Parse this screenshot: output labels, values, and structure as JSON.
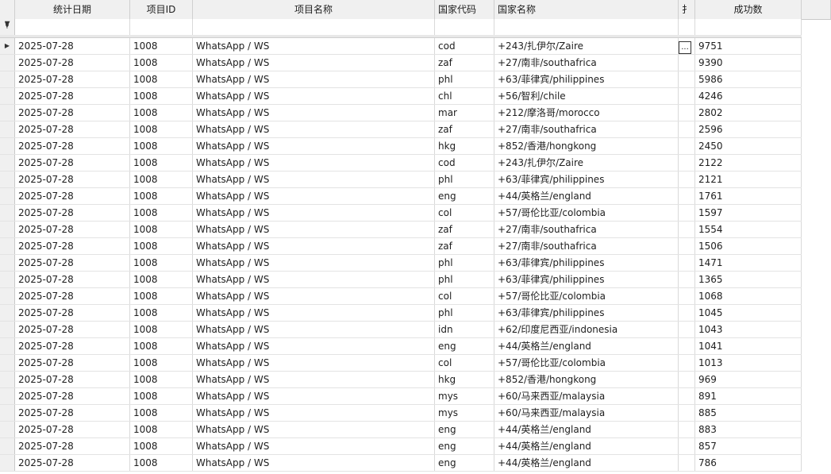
{
  "headers": {
    "date": "统计日期",
    "project_id": "项目ID",
    "project_name": "项目名称",
    "country_code": "国家代码",
    "country_name": "国家名称",
    "extra": "扌",
    "success_count": "成功数"
  },
  "filter_icon": "filter-pin-icon",
  "row_indicator_icon": "current-row-arrow-icon",
  "ellipsis_label": "...",
  "rows": [
    {
      "date": "2025-07-28",
      "project_id": "1008",
      "project_name": "WhatsApp / WS",
      "country_code": "cod",
      "country_name": "+243/扎伊尔/Zaire",
      "success_count": "9751"
    },
    {
      "date": "2025-07-28",
      "project_id": "1008",
      "project_name": "WhatsApp / WS",
      "country_code": "zaf",
      "country_name": "+27/南非/southafrica",
      "success_count": "9390"
    },
    {
      "date": "2025-07-28",
      "project_id": "1008",
      "project_name": "WhatsApp / WS",
      "country_code": "phl",
      "country_name": "+63/菲律宾/philippines",
      "success_count": "5986"
    },
    {
      "date": "2025-07-28",
      "project_id": "1008",
      "project_name": "WhatsApp / WS",
      "country_code": "chl",
      "country_name": "+56/智利/chile",
      "success_count": "4246"
    },
    {
      "date": "2025-07-28",
      "project_id": "1008",
      "project_name": "WhatsApp / WS",
      "country_code": "mar",
      "country_name": "+212/摩洛哥/morocco",
      "success_count": "2802"
    },
    {
      "date": "2025-07-28",
      "project_id": "1008",
      "project_name": "WhatsApp / WS",
      "country_code": "zaf",
      "country_name": "+27/南非/southafrica",
      "success_count": "2596"
    },
    {
      "date": "2025-07-28",
      "project_id": "1008",
      "project_name": "WhatsApp / WS",
      "country_code": "hkg",
      "country_name": "+852/香港/hongkong",
      "success_count": "2450"
    },
    {
      "date": "2025-07-28",
      "project_id": "1008",
      "project_name": "WhatsApp / WS",
      "country_code": "cod",
      "country_name": "+243/扎伊尔/Zaire",
      "success_count": "2122"
    },
    {
      "date": "2025-07-28",
      "project_id": "1008",
      "project_name": "WhatsApp / WS",
      "country_code": "phl",
      "country_name": "+63/菲律宾/philippines",
      "success_count": "2121"
    },
    {
      "date": "2025-07-28",
      "project_id": "1008",
      "project_name": "WhatsApp / WS",
      "country_code": "eng",
      "country_name": "+44/英格兰/england",
      "success_count": "1761"
    },
    {
      "date": "2025-07-28",
      "project_id": "1008",
      "project_name": "WhatsApp / WS",
      "country_code": "col",
      "country_name": "+57/哥伦比亚/colombia",
      "success_count": "1597"
    },
    {
      "date": "2025-07-28",
      "project_id": "1008",
      "project_name": "WhatsApp / WS",
      "country_code": "zaf",
      "country_name": "+27/南非/southafrica",
      "success_count": "1554"
    },
    {
      "date": "2025-07-28",
      "project_id": "1008",
      "project_name": "WhatsApp / WS",
      "country_code": "zaf",
      "country_name": "+27/南非/southafrica",
      "success_count": "1506"
    },
    {
      "date": "2025-07-28",
      "project_id": "1008",
      "project_name": "WhatsApp / WS",
      "country_code": "phl",
      "country_name": "+63/菲律宾/philippines",
      "success_count": "1471"
    },
    {
      "date": "2025-07-28",
      "project_id": "1008",
      "project_name": "WhatsApp / WS",
      "country_code": "phl",
      "country_name": "+63/菲律宾/philippines",
      "success_count": "1365"
    },
    {
      "date": "2025-07-28",
      "project_id": "1008",
      "project_name": "WhatsApp / WS",
      "country_code": "col",
      "country_name": "+57/哥伦比亚/colombia",
      "success_count": "1068"
    },
    {
      "date": "2025-07-28",
      "project_id": "1008",
      "project_name": "WhatsApp / WS",
      "country_code": "phl",
      "country_name": "+63/菲律宾/philippines",
      "success_count": "1045"
    },
    {
      "date": "2025-07-28",
      "project_id": "1008",
      "project_name": "WhatsApp / WS",
      "country_code": "idn",
      "country_name": "+62/印度尼西亚/indonesia",
      "success_count": "1043"
    },
    {
      "date": "2025-07-28",
      "project_id": "1008",
      "project_name": "WhatsApp / WS",
      "country_code": "eng",
      "country_name": "+44/英格兰/england",
      "success_count": "1041"
    },
    {
      "date": "2025-07-28",
      "project_id": "1008",
      "project_name": "WhatsApp / WS",
      "country_code": "col",
      "country_name": "+57/哥伦比亚/colombia",
      "success_count": "1013"
    },
    {
      "date": "2025-07-28",
      "project_id": "1008",
      "project_name": "WhatsApp / WS",
      "country_code": "hkg",
      "country_name": "+852/香港/hongkong",
      "success_count": "969"
    },
    {
      "date": "2025-07-28",
      "project_id": "1008",
      "project_name": "WhatsApp / WS",
      "country_code": "mys",
      "country_name": "+60/马来西亚/malaysia",
      "success_count": "891"
    },
    {
      "date": "2025-07-28",
      "project_id": "1008",
      "project_name": "WhatsApp / WS",
      "country_code": "mys",
      "country_name": "+60/马来西亚/malaysia",
      "success_count": "885"
    },
    {
      "date": "2025-07-28",
      "project_id": "1008",
      "project_name": "WhatsApp / WS",
      "country_code": "eng",
      "country_name": "+44/英格兰/england",
      "success_count": "883"
    },
    {
      "date": "2025-07-28",
      "project_id": "1008",
      "project_name": "WhatsApp / WS",
      "country_code": "eng",
      "country_name": "+44/英格兰/england",
      "success_count": "857"
    },
    {
      "date": "2025-07-28",
      "project_id": "1008",
      "project_name": "WhatsApp / WS",
      "country_code": "eng",
      "country_name": "+44/英格兰/england",
      "success_count": "786"
    }
  ]
}
